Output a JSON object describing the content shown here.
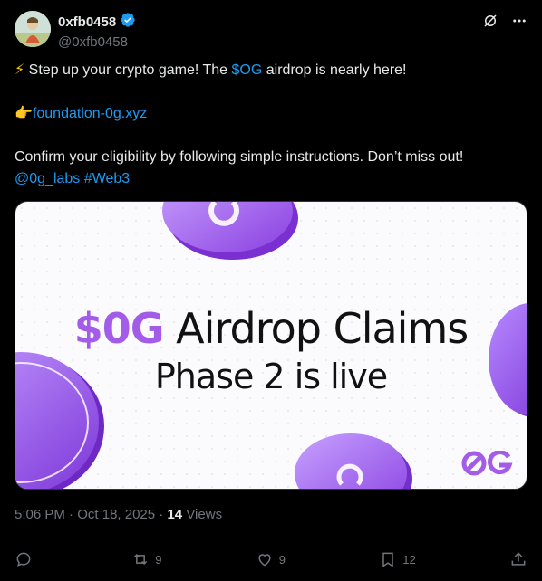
{
  "author": {
    "display_name": "0xfb0458",
    "handle": "@0xfb0458"
  },
  "tweet": {
    "line1": {
      "emoji": "⚡",
      "pre": " Step up your crypto game! The ",
      "ticker": "$OG",
      "post": " airdrop is nearly here!"
    },
    "line2": {
      "emoji": "👉",
      "link": "foundatlon-0g.xyz"
    },
    "line3": "Confirm your eligibility by following simple instructions. Don’t miss out!",
    "mentions": {
      "mention": "@0g_labs",
      "hashtag": "#Web3"
    }
  },
  "media": {
    "title_ticker": "$0G",
    "title_rest": " Airdrop Claims",
    "subtitle": "Phase 2 is live",
    "logo_text": "0G"
  },
  "meta": {
    "time": "5:06 PM",
    "separator1": " · ",
    "date": "Oct 18, 2025",
    "separator2": " · ",
    "views_count": "14",
    "views_label": " Views"
  },
  "actions": {
    "reply_count": "",
    "retweet_count": "9",
    "like_count": "9",
    "bookmark_count": "12"
  },
  "colors": {
    "background": "#000000",
    "link": "#1d9bf0",
    "muted": "#71767b",
    "verified": "#1d9bf0",
    "brand_purple": "#a35ce8"
  }
}
